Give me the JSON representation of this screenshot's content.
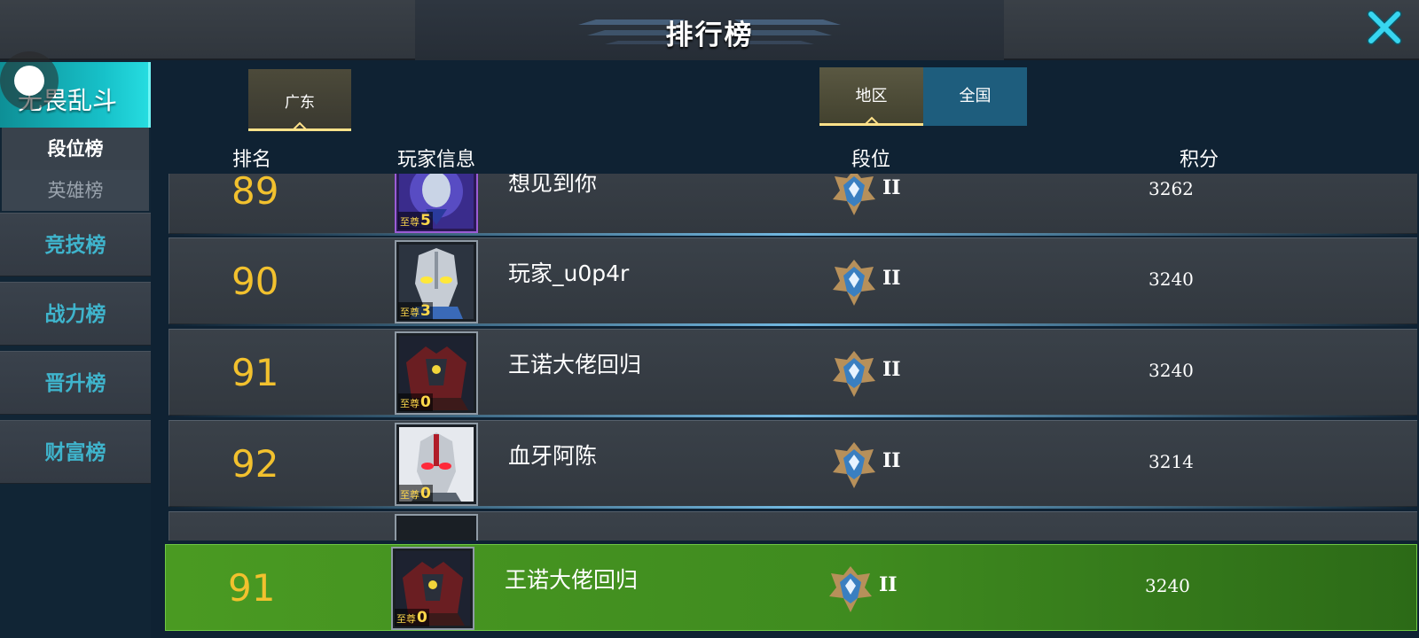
{
  "header": {
    "title": "排行榜",
    "close_icon": "close-x-icon",
    "close_color": "#38d6f0"
  },
  "sidebar": {
    "mode_label": "无畏乱斗",
    "subtabs": [
      {
        "label": "段位榜",
        "active": true
      },
      {
        "label": "英雄榜",
        "active": false
      }
    ],
    "items": [
      {
        "label": "竞技榜"
      },
      {
        "label": "战力榜"
      },
      {
        "label": "晋升榜"
      },
      {
        "label": "财富榜"
      }
    ]
  },
  "filters": {
    "region": "广东",
    "tabs": [
      {
        "label": "地区",
        "selected": true
      },
      {
        "label": "全国",
        "selected": false
      }
    ]
  },
  "columns": {
    "rank": "排名",
    "player": "玩家信息",
    "tier": "段位",
    "score": "积分"
  },
  "leaderboard": [
    {
      "rank": "89",
      "name": "想见到你",
      "vip_label": "至尊",
      "vip_level": "5",
      "tier": "II",
      "score": "3262",
      "avatar": "purple-hero-avatar"
    },
    {
      "rank": "90",
      "name": "玩家_u0p4r",
      "vip_label": "至尊",
      "vip_level": "3",
      "tier": "II",
      "score": "3240",
      "avatar": "silver-hero-avatar"
    },
    {
      "rank": "91",
      "name": "王诺大佬回归",
      "vip_label": "至尊",
      "vip_level": "0",
      "tier": "II",
      "score": "3240",
      "avatar": "dark-armor-avatar"
    },
    {
      "rank": "92",
      "name": "血牙阿陈",
      "vip_label": "至尊",
      "vip_level": "0",
      "tier": "II",
      "score": "3214",
      "avatar": "red-eye-hero-avatar"
    }
  ],
  "my_rank": {
    "rank": "91",
    "name": "王诺大佬回归",
    "vip_label": "至尊",
    "vip_level": "0",
    "tier": "II",
    "score": "3240",
    "avatar": "dark-armor-avatar"
  },
  "colors": {
    "rank": "#f2c12e",
    "accent_cyan": "#17c1c9",
    "gold_underline": "#ffe28a",
    "my_row": "#4a9a22"
  }
}
